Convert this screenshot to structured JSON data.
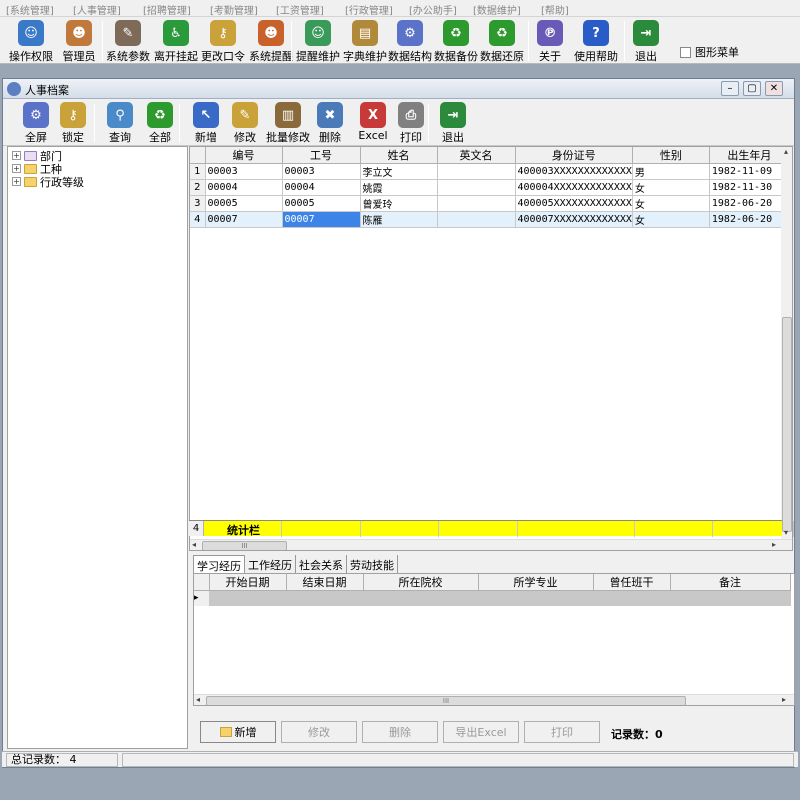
{
  "menu": [
    "[系统管理]",
    "[人事管理]",
    "[招聘管理]",
    "[考勤管理]",
    "[工资管理]",
    "[行政管理]",
    "[办公助手]",
    "[数据维护]",
    "[帮助]"
  ],
  "main_toolbar": [
    {
      "label": "操作权限",
      "icon": "permission-icon",
      "color": "#3a78c8",
      "glyph": "☺"
    },
    {
      "label": "管理员",
      "icon": "admin-icon",
      "color": "#c0793a",
      "glyph": "☻"
    },
    {
      "label": "系统参数",
      "icon": "parameters-icon",
      "color": "#7d6a58",
      "glyph": "✎"
    },
    {
      "label": "离开挂起",
      "icon": "leave-icon",
      "color": "#2b9a3c",
      "glyph": "♿"
    },
    {
      "label": "更改口令",
      "icon": "key-icon",
      "color": "#c9a23a",
      "glyph": "⚷"
    },
    {
      "label": "系统提醒",
      "icon": "users-icon",
      "color": "#c8612a",
      "glyph": "☻"
    },
    {
      "label": "提醒维护",
      "icon": "reminder-icon",
      "color": "#3a9a5a",
      "glyph": "☺"
    },
    {
      "label": "字典维护",
      "icon": "dictionary-icon",
      "color": "#b08a3a",
      "glyph": "▤"
    },
    {
      "label": "数据结构",
      "icon": "gear-icon",
      "color": "#5a72c8",
      "glyph": "⚙"
    },
    {
      "label": "数据备份",
      "icon": "recycle-icon",
      "color": "#2c9a2c",
      "glyph": "♻"
    },
    {
      "label": "数据还原",
      "icon": "recycle-icon",
      "color": "#2c9a2c",
      "glyph": "♻"
    },
    {
      "label": "关于",
      "icon": "about-icon",
      "color": "#6a5ab8",
      "glyph": "℗"
    },
    {
      "label": "使用帮助",
      "icon": "help-icon",
      "color": "#2a5cc8",
      "glyph": "?"
    },
    {
      "label": "退出",
      "icon": "exit-icon",
      "color": "#2c8a3c",
      "glyph": "⇥"
    }
  ],
  "graphic_menu_label": "图形菜单",
  "window": {
    "title": "人事档案",
    "min": "–",
    "max": "▢",
    "close": "✕"
  },
  "sub_toolbar": [
    {
      "label": "全屏",
      "icon": "fullscreen-gear-icon",
      "color": "#5a72c8",
      "glyph": "⚙"
    },
    {
      "label": "锁定",
      "icon": "lock-key-icon",
      "color": "#c9a23a",
      "glyph": "⚷"
    },
    {
      "label": "查询",
      "icon": "search-icon",
      "color": "#4a8ac8",
      "glyph": "⚲"
    },
    {
      "label": "全部",
      "icon": "recycle-icon",
      "color": "#2c9a2c",
      "glyph": "♻"
    },
    {
      "label": "新增",
      "icon": "add-icon",
      "color": "#3a6ac8",
      "glyph": "↖"
    },
    {
      "label": "修改",
      "icon": "edit-folder-icon",
      "color": "#c9a23a",
      "glyph": "✎"
    },
    {
      "label": "批量修改",
      "icon": "batch-edit-icon",
      "color": "#8a6a3a",
      "glyph": "▥"
    },
    {
      "label": "删除",
      "icon": "delete-icon",
      "color": "#4a7ab8",
      "glyph": "✖"
    },
    {
      "label": "Excel",
      "icon": "excel-icon",
      "color": "#c83a3a",
      "glyph": "X"
    },
    {
      "label": "打印",
      "icon": "printer-icon",
      "color": "#808080",
      "glyph": "⎙"
    },
    {
      "label": "退出",
      "icon": "exit-icon",
      "color": "#2c8a3c",
      "glyph": "⇥"
    }
  ],
  "tree": [
    "部门",
    "工种",
    "行政等级"
  ],
  "grid": {
    "columns": [
      "编号",
      "工号",
      "姓名",
      "英文名",
      "身份证号",
      "性别",
      "出生年月"
    ],
    "rows": [
      {
        "n": "1",
        "cells": [
          "00003",
          "00003",
          "李立文",
          "",
          "400003XXXXXXXXXXXXX",
          "男",
          "1982-11-09"
        ]
      },
      {
        "n": "2",
        "cells": [
          "00004",
          "00004",
          "姚霞",
          "",
          "400004XXXXXXXXXXXXX",
          "女",
          "1982-11-30"
        ]
      },
      {
        "n": "3",
        "cells": [
          "00005",
          "00005",
          "曾爱玲",
          "",
          "400005XXXXXXXXXXXXX",
          "女",
          "1982-06-20"
        ]
      },
      {
        "n": "4",
        "cells": [
          "00007",
          "00007",
          "陈雁",
          "",
          "400007XXXXXXXXXXXXX",
          "女",
          "1982-06-20"
        ]
      }
    ],
    "total_row_number": "4",
    "total_label": "统计栏"
  },
  "tabs": [
    "学习经历",
    "工作经历",
    "社会关系",
    "劳动技能"
  ],
  "sub_grid_columns": [
    "开始日期",
    "结束日期",
    "所在院校",
    "所学专业",
    "曾任班干",
    "备注"
  ],
  "bottom_buttons": [
    {
      "label": "新增",
      "enabled": true
    },
    {
      "label": "修改",
      "enabled": false
    },
    {
      "label": "删除",
      "enabled": false
    },
    {
      "label": "导出Excel",
      "enabled": false
    },
    {
      "label": "打印",
      "enabled": false
    }
  ],
  "record_count": "记录数：0",
  "status": {
    "label": "总记录数：",
    "value": "4"
  },
  "scroll_glyphs": {
    "left": "◂",
    "right": "▸",
    "up": "▴",
    "down": "▾",
    "grip": "III"
  }
}
